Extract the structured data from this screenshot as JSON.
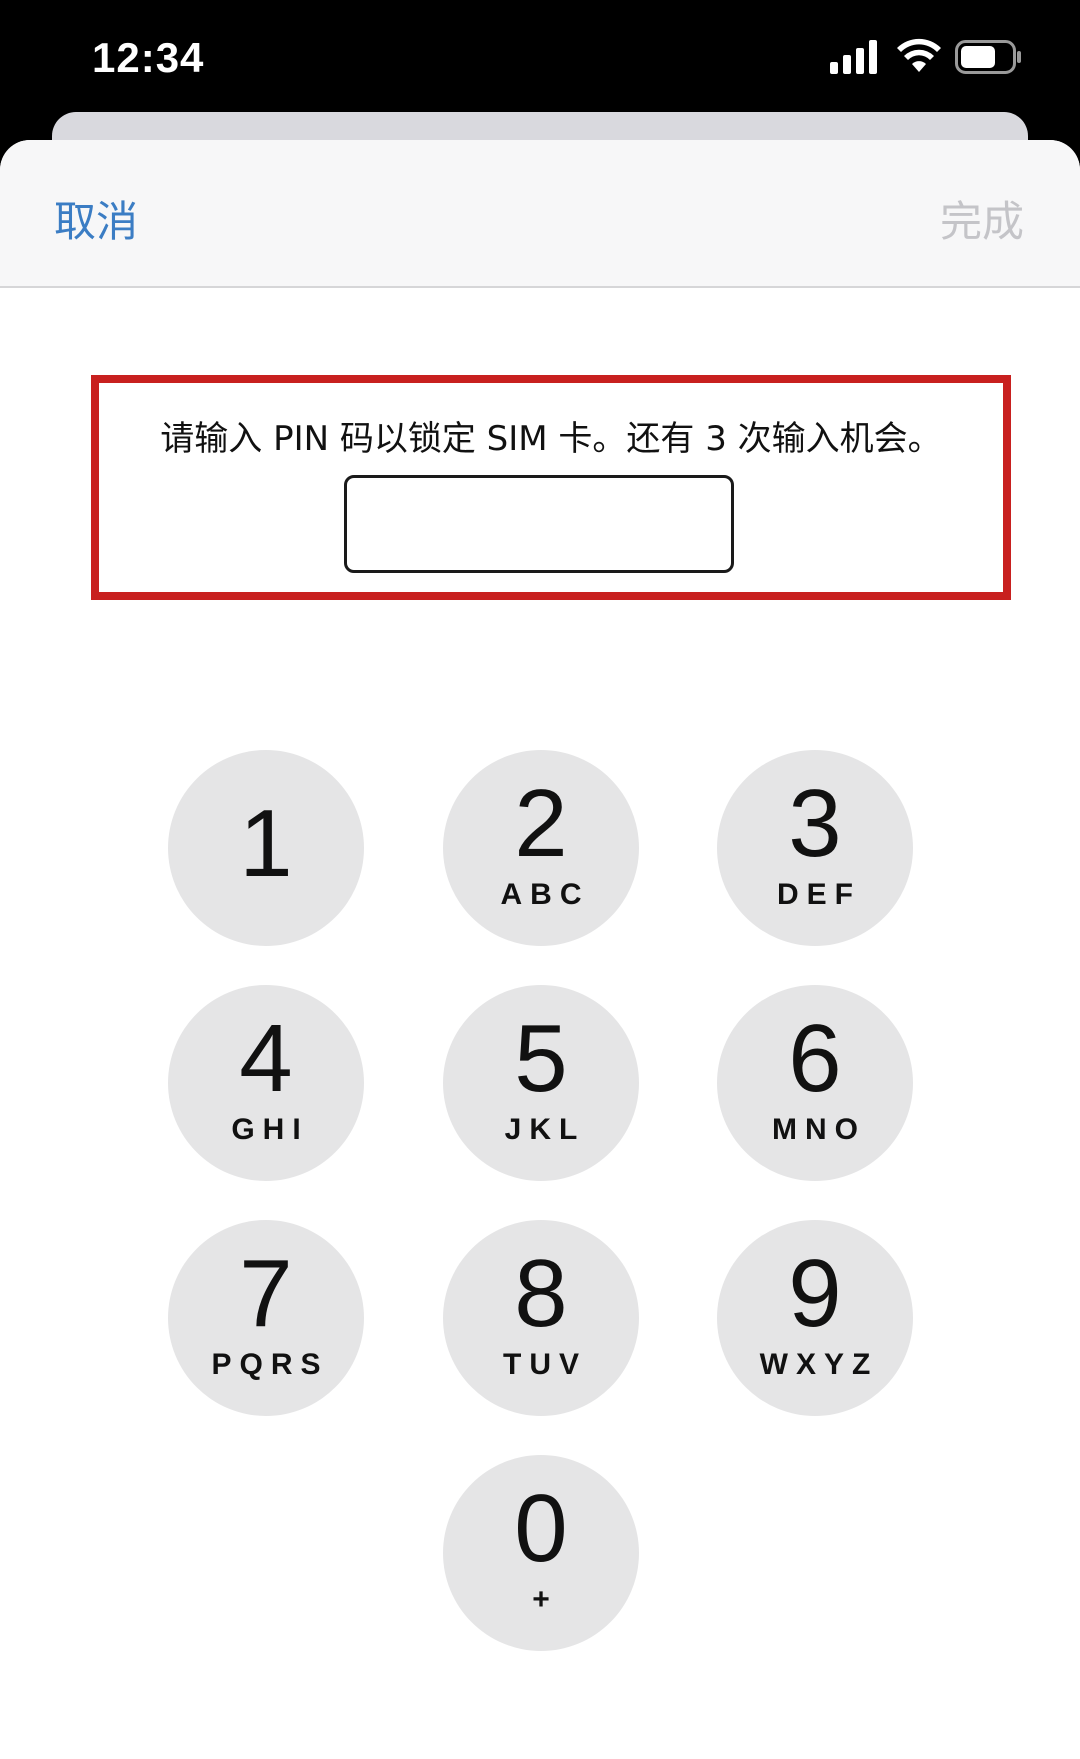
{
  "status_bar": {
    "time": "12:34",
    "icons": [
      "signal-icon",
      "wifi-icon",
      "battery-icon"
    ]
  },
  "nav": {
    "cancel_label": "取消",
    "done_label": "完成"
  },
  "prompt": {
    "text": "请输入 PIN 码以锁定 SIM 卡。还有 3 次输入机会。",
    "pin_value": ""
  },
  "keypad": {
    "keys": [
      {
        "digit": "1",
        "letters": ""
      },
      {
        "digit": "2",
        "letters": "ABC"
      },
      {
        "digit": "3",
        "letters": "DEF"
      },
      {
        "digit": "4",
        "letters": "GHI"
      },
      {
        "digit": "5",
        "letters": "JKL"
      },
      {
        "digit": "6",
        "letters": "MNO"
      },
      {
        "digit": "7",
        "letters": "PQRS"
      },
      {
        "digit": "8",
        "letters": "TUV"
      },
      {
        "digit": "9",
        "letters": "WXYZ"
      },
      {
        "digit": "0",
        "letters": "+"
      }
    ]
  },
  "colors": {
    "accent": "#3b7dc4",
    "disabled": "#c4c4c8",
    "highlight": "#c8201f",
    "key_background": "#e5e5e6"
  }
}
